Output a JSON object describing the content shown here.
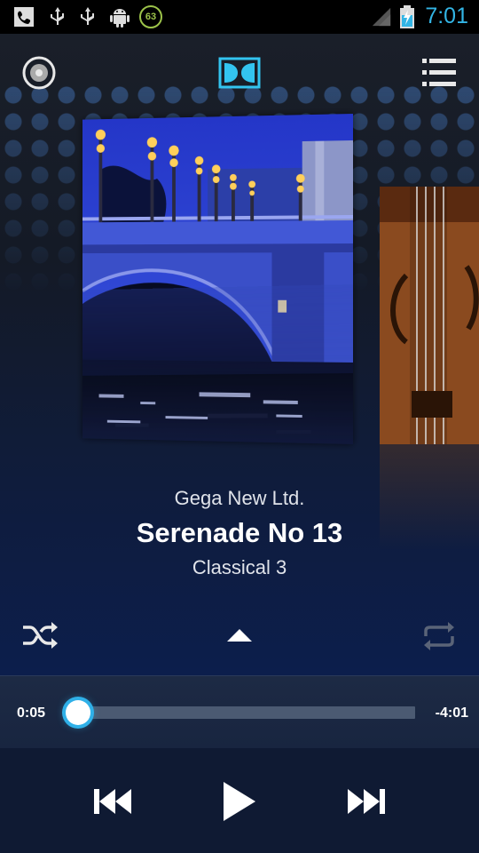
{
  "status_bar": {
    "time": "7:01",
    "battery_badge": "63"
  },
  "track": {
    "artist": "Gega New Ltd.",
    "title": "Serenade No 13",
    "album": "Classical 3"
  },
  "progress": {
    "elapsed": "0:05",
    "remaining": "-4:01",
    "fraction": 0.02
  },
  "icons": {
    "disc": "disc-icon",
    "dolby": "dolby-logo-icon",
    "playlist": "playlist-menu-icon",
    "shuffle": "shuffle-icon",
    "expand": "expand-up-icon",
    "repeat": "repeat-icon",
    "previous": "previous-track-icon",
    "play": "play-icon",
    "next": "next-track-icon"
  },
  "colors": {
    "accent": "#33b5e5",
    "battery_badge": "#9cc34a"
  }
}
